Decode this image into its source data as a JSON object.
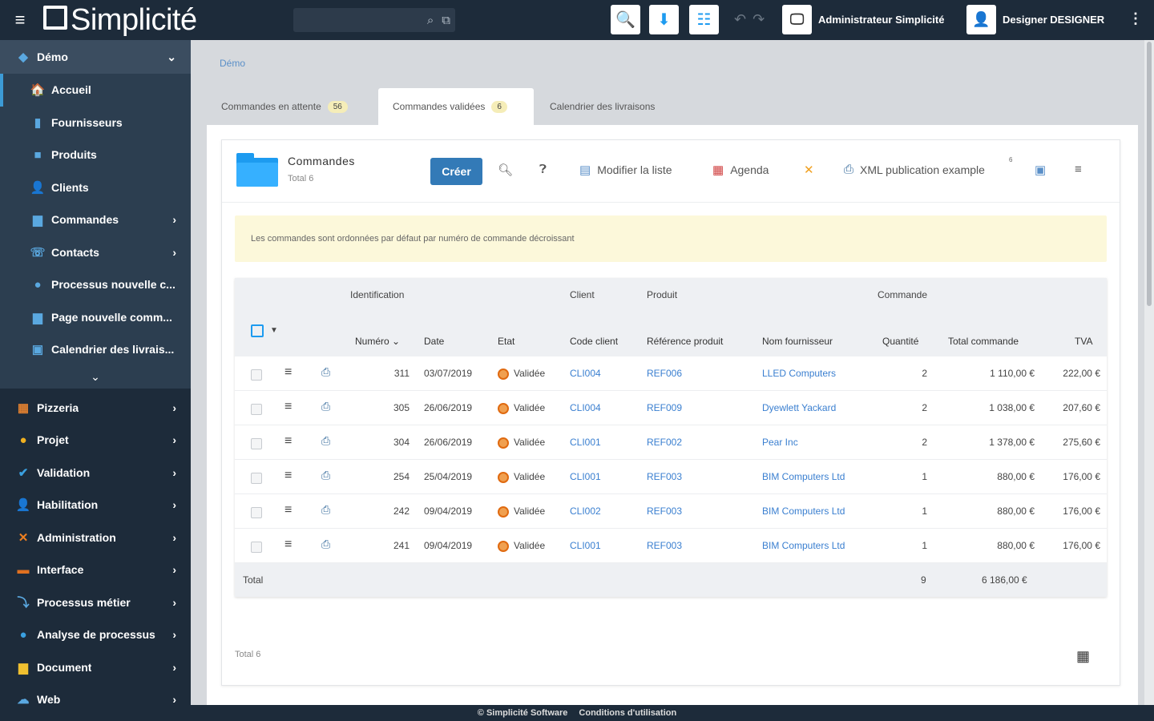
{
  "header": {
    "app_name": "Simplicité",
    "user_label": "Administrateur Simplicité",
    "designer_label": "Designer DESIGNER"
  },
  "sidebar": {
    "scope": "Démo",
    "items": [
      {
        "label": "Accueil",
        "icon": "home-icon",
        "glyph": "🏠",
        "chevron": ""
      },
      {
        "label": "Fournisseurs",
        "icon": "supplier-icon",
        "glyph": "▮",
        "chevron": ""
      },
      {
        "label": "Produits",
        "icon": "product-icon",
        "glyph": "■",
        "chevron": ""
      },
      {
        "label": "Clients",
        "icon": "client-icon",
        "glyph": "👤",
        "chevron": ""
      },
      {
        "label": "Commandes",
        "icon": "folder-icon",
        "glyph": "▆",
        "chevron": "›"
      },
      {
        "label": "Contacts",
        "icon": "contact-icon",
        "glyph": "☏",
        "chevron": "›"
      },
      {
        "label": "Processus nouvelle c...",
        "icon": "process-icon",
        "glyph": "●",
        "chevron": ""
      },
      {
        "label": "Page nouvelle comm...",
        "icon": "page-icon",
        "glyph": "▆",
        "chevron": ""
      },
      {
        "label": "Calendrier des livrais...",
        "icon": "calendar-icon",
        "glyph": "▣",
        "chevron": ""
      }
    ],
    "modules": [
      {
        "label": "Pizzeria",
        "icon": "pizzeria-icon",
        "glyph": "▦"
      },
      {
        "label": "Projet",
        "icon": "project-icon",
        "glyph": "●"
      },
      {
        "label": "Validation",
        "icon": "validation-icon",
        "glyph": "✔"
      },
      {
        "label": "Habilitation",
        "icon": "user-rights-icon",
        "glyph": "👤"
      },
      {
        "label": "Administration",
        "icon": "admin-tools-icon",
        "glyph": "✕"
      },
      {
        "label": "Interface",
        "icon": "interface-icon",
        "glyph": "▬"
      },
      {
        "label": "Processus métier",
        "icon": "business-process-icon",
        "glyph": "⤵"
      },
      {
        "label": "Analyse de processus",
        "icon": "process-analysis-icon",
        "glyph": "●"
      },
      {
        "label": "Document",
        "icon": "document-icon",
        "glyph": "▆"
      },
      {
        "label": "Web",
        "icon": "web-icon",
        "glyph": "☁"
      }
    ]
  },
  "breadcrumb": "Démo",
  "tabs": [
    {
      "label": "Commandes en attente",
      "count": "56"
    },
    {
      "label": "Commandes validées",
      "count": "6"
    },
    {
      "label": "Calendrier des livraisons",
      "count": ""
    }
  ],
  "object": {
    "title": "Commandes",
    "subtitle": "Total 6",
    "create_label": "Créer",
    "actions": {
      "edit_list": "Modifier la liste",
      "agenda": "Agenda",
      "xml_pub": "XML publication example",
      "xml_badge": "6"
    }
  },
  "notice": "Les commandes sont ordonnées par défaut par numéro de commande décroissant",
  "table": {
    "groups": {
      "identification": "Identification",
      "client": "Client",
      "product": "Produit",
      "order": "Commande"
    },
    "columns": {
      "number": "Numéro",
      "date": "Date",
      "state": "Etat",
      "client_code": "Code client",
      "product_ref": "Référence produit",
      "supplier": "Nom fournisseur",
      "quantity": "Quantité",
      "total": "Total commande",
      "vat": "TVA"
    },
    "rows": [
      {
        "number": "311",
        "date": "03/07/2019",
        "state": "Validée",
        "client": "CLI004",
        "product": "REF006",
        "supplier": "LLED Computers",
        "qty": "2",
        "total": "1 110,00 €",
        "vat": "222,00 €"
      },
      {
        "number": "305",
        "date": "26/06/2019",
        "state": "Validée",
        "client": "CLI004",
        "product": "REF009",
        "supplier": "Dyewlett Yackard",
        "qty": "2",
        "total": "1 038,00 €",
        "vat": "207,60 €"
      },
      {
        "number": "304",
        "date": "26/06/2019",
        "state": "Validée",
        "client": "CLI001",
        "product": "REF002",
        "supplier": "Pear Inc",
        "qty": "2",
        "total": "1 378,00 €",
        "vat": "275,60 €"
      },
      {
        "number": "254",
        "date": "25/04/2019",
        "state": "Validée",
        "client": "CLI001",
        "product": "REF003",
        "supplier": "BIM Computers Ltd",
        "qty": "1",
        "total": "880,00 €",
        "vat": "176,00 €"
      },
      {
        "number": "242",
        "date": "09/04/2019",
        "state": "Validée",
        "client": "CLI002",
        "product": "REF003",
        "supplier": "BIM Computers Ltd",
        "qty": "1",
        "total": "880,00 €",
        "vat": "176,00 €"
      },
      {
        "number": "241",
        "date": "09/04/2019",
        "state": "Validée",
        "client": "CLI001",
        "product": "REF003",
        "supplier": "BIM Computers Ltd",
        "qty": "1",
        "total": "880,00 €",
        "vat": "176,00 €"
      }
    ],
    "total_label": "Total",
    "total_qty": "9",
    "total_amount": "6 186,00 €"
  },
  "footer_total": "Total 6",
  "footer": {
    "copyright": "© Simplicité Software",
    "terms": "Conditions d'utilisation"
  },
  "colors": {
    "topbar": "#1d2b3a",
    "accent": "#337ab7",
    "link": "#3a7fd0",
    "notice_bg": "#fcf8da"
  }
}
